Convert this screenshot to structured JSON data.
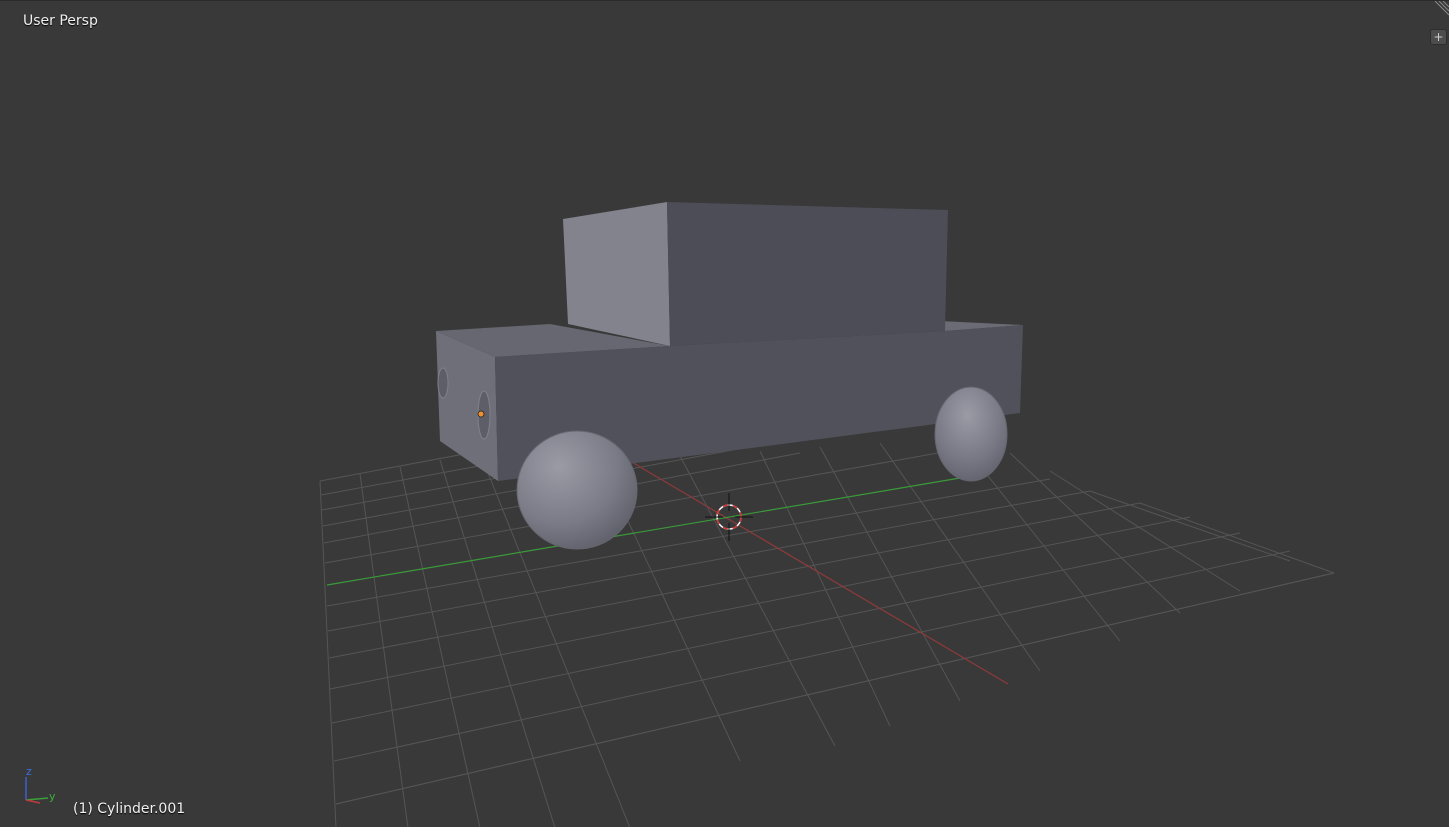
{
  "viewport": {
    "view_name": "User Persp",
    "active_object": "(1) Cylinder.001"
  },
  "axis_gizmo": {
    "z_label": "z",
    "y_label": "y"
  },
  "toolbar": {
    "add_region_glyph": "+"
  },
  "colors": {
    "background": "#393939",
    "grid": "#555555",
    "x_axis": "#9a3a3a",
    "y_axis": "#3a9a3a",
    "mesh_light": "#8a8b93",
    "mesh_dark": "#4b4c55",
    "origin_dot": "#f09030"
  },
  "icons": {
    "corner": "area-split-corner-icon",
    "cursor": "3d-cursor-icon",
    "origin": "object-origin-icon",
    "gizmo": "axis-gizmo-icon"
  }
}
